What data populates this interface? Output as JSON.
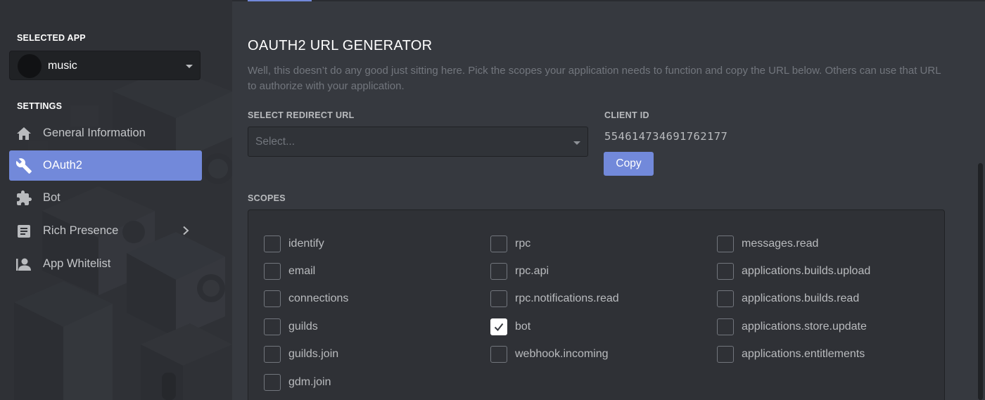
{
  "sidebar": {
    "selected_app_heading": "SELECTED APP",
    "selected_app": {
      "name": "music"
    },
    "settings_heading": "SETTINGS",
    "items": [
      {
        "label": "General Information",
        "icon": "home-icon",
        "active": false
      },
      {
        "label": "OAuth2",
        "icon": "wrench-icon",
        "active": true
      },
      {
        "label": "Bot",
        "icon": "puzzle-icon",
        "active": false
      },
      {
        "label": "Rich Presence",
        "icon": "document-icon",
        "active": false,
        "has_submenu": true
      },
      {
        "label": "App Whitelist",
        "icon": "user-icon",
        "active": false
      }
    ]
  },
  "main": {
    "title": "OAUTH2 URL GENERATOR",
    "description": "Well, this doesn’t do any good just sitting here. Pick the scopes your application needs to function and copy the URL below. Others can use that URL to authorize with your application.",
    "redirect": {
      "label": "SELECT REDIRECT URL",
      "placeholder": "Select..."
    },
    "client": {
      "label": "CLIENT ID",
      "id": "554614734691762177",
      "copy_label": "Copy"
    },
    "scopes": {
      "label": "SCOPES",
      "columns": [
        [
          {
            "name": "identify",
            "checked": false
          },
          {
            "name": "email",
            "checked": false
          },
          {
            "name": "connections",
            "checked": false
          },
          {
            "name": "guilds",
            "checked": false
          },
          {
            "name": "guilds.join",
            "checked": false
          },
          {
            "name": "gdm.join",
            "checked": false
          }
        ],
        [
          {
            "name": "rpc",
            "checked": false
          },
          {
            "name": "rpc.api",
            "checked": false
          },
          {
            "name": "rpc.notifications.read",
            "checked": false
          },
          {
            "name": "bot",
            "checked": true
          },
          {
            "name": "webhook.incoming",
            "checked": false
          }
        ],
        [
          {
            "name": "messages.read",
            "checked": false
          },
          {
            "name": "applications.builds.upload",
            "checked": false
          },
          {
            "name": "applications.builds.read",
            "checked": false
          },
          {
            "name": "applications.store.update",
            "checked": false
          },
          {
            "name": "applications.entitlements",
            "checked": false
          }
        ]
      ]
    }
  },
  "colors": {
    "accent": "#7289da",
    "sidebar_bg": "#2f3136",
    "main_bg": "#36393f",
    "input_bg": "#303338",
    "muted_text": "#72767d"
  }
}
